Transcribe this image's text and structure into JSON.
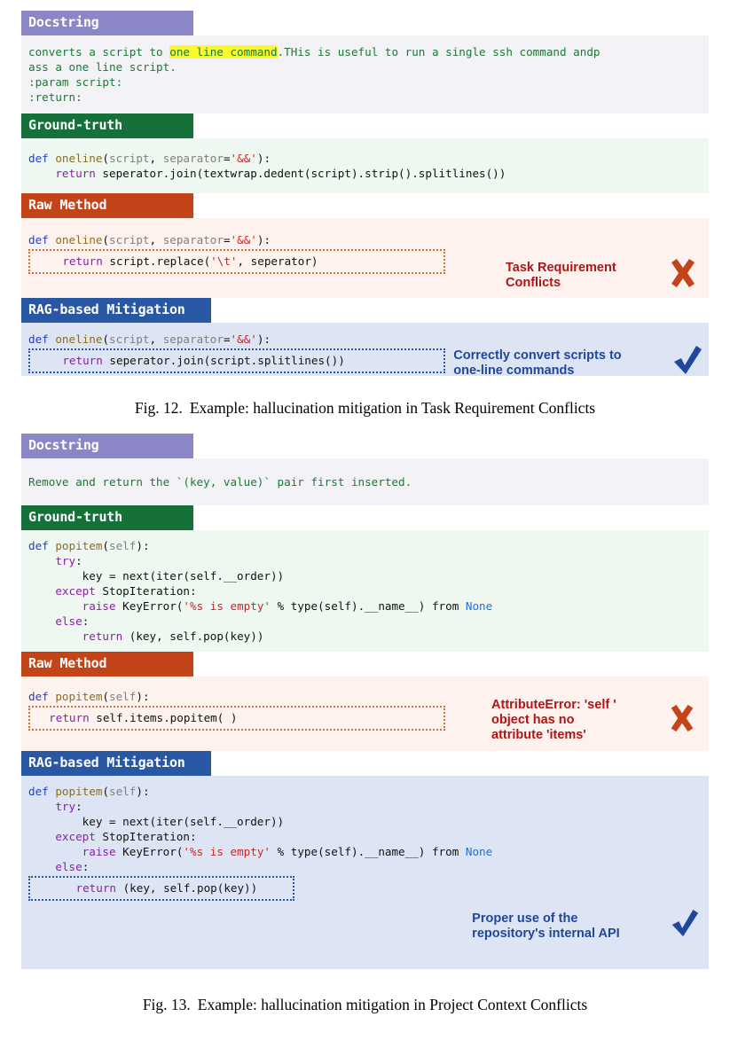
{
  "figures": [
    {
      "id": "fig-12",
      "panels": {
        "docstring": {
          "header": "Docstring",
          "line1_pre": "converts a script to ",
          "line1_hl": "one line command",
          "line1_post": ".THis is useful to run a single ssh command andp",
          "line2": "ass a one line script.",
          "line3": ":param script:",
          "line4": ":return:"
        },
        "ground_truth": {
          "header": "Ground-truth",
          "code": {
            "def_kw": "def",
            "fn": " oneline",
            "sig_open": "(",
            "arg1": "script",
            "sep": ", ",
            "arg2": "separator",
            "eq": "=",
            "str": "'&&'",
            "sig_close": "):",
            "ret_kw": "return",
            "ret_body": " seperator.join(textwrap.dedent(script).strip().splitlines())"
          }
        },
        "raw_method": {
          "header": "Raw Method",
          "code": {
            "def_kw": "def",
            "fn": " oneline",
            "sig_open": "(",
            "arg1": "script",
            "sep": ", ",
            "arg2": "separator",
            "eq": "=",
            "str": "'&&'",
            "sig_close": "):",
            "ret_kw": "return",
            "ret_mid": " script.replace(",
            "ret_str": "'\\t'",
            "ret_end": ", seperator)"
          },
          "annotation": "Task Requirement\nConflicts",
          "mark": "cross-icon"
        },
        "rag_mitigation": {
          "header": "RAG-based Mitigation",
          "code": {
            "def_kw": "def",
            "fn": " oneline",
            "sig_open": "(",
            "arg1": "script",
            "sep": ", ",
            "arg2": "separator",
            "eq": "=",
            "str": "'&&'",
            "sig_close": "):",
            "ret_kw": "return",
            "ret_body": " seperator.join(script.splitlines())"
          },
          "annotation": "Correctly convert scripts to\none-line commands",
          "mark": "check-icon"
        }
      },
      "caption_label": "Fig. 12.",
      "caption_text": "Example: hallucination mitigation in Task Requirement Conflicts"
    },
    {
      "id": "fig-13",
      "panels": {
        "docstring": {
          "header": "Docstring",
          "line1": "Remove and return the `(key, value)` pair first inserted."
        },
        "ground_truth": {
          "header": "Ground-truth",
          "code": {
            "def_kw": "def",
            "fn": " popitem",
            "sig_open": "(",
            "arg1": "self",
            "sig_close": "):",
            "try_kw": "try",
            "try_colon": ":",
            "key_line": "key = next(iter(self.__order))",
            "except_kw": "except",
            "except_rest": " StopIteration:",
            "raise_kw": "raise",
            "raise_mid": " KeyError(",
            "raise_str1": "'%s is empty'",
            "raise_mid2": " % type(self).__name__) from ",
            "raise_none": "None",
            "else_kw": "else",
            "else_colon": ":",
            "ret_kw": "return",
            "ret_body": " (key, self.pop(key))"
          }
        },
        "raw_method": {
          "header": "Raw Method",
          "code": {
            "def_kw": "def",
            "fn": " popitem",
            "sig_open": "(",
            "arg1": "self",
            "sig_close": "):",
            "ret_kw": "return",
            "ret_body": " self.items.popitem( )"
          },
          "annotation": "AttributeError: 'self '\nobject has no\nattribute 'items'",
          "mark": "cross-icon"
        },
        "rag_mitigation": {
          "header": "RAG-based Mitigation",
          "code": {
            "def_kw": "def",
            "fn": " popitem",
            "sig_open": "(",
            "arg1": "self",
            "sig_close": "):",
            "try_kw": "try",
            "try_colon": ":",
            "key_line": "key = next(iter(self.__order))",
            "except_kw": "except",
            "except_rest": " StopIteration:",
            "raise_kw": "raise",
            "raise_mid": " KeyError(",
            "raise_str1": "'%s is empty'",
            "raise_mid2": " % type(self).__name__) from ",
            "raise_none": "None",
            "else_kw": "else",
            "else_colon": ":",
            "ret_kw": "return",
            "ret_body": " (key, self.pop(key))"
          },
          "annotation": "Proper use of the\nrepository's internal API",
          "mark": "check-icon"
        }
      },
      "caption_label": "Fig. 13.",
      "caption_text": "Example: hallucination mitigation in Project Context Conflicts"
    }
  ],
  "colors": {
    "docstring_header": "#8b86c6",
    "ground_truth_header": "#16703a",
    "raw_method_header": "#c4441a",
    "rag_header": "#2857a4",
    "highlight": "#fcf92a",
    "bad_text": "#b01515",
    "cross": "#c4441a",
    "good_text": "#20479b",
    "check": "#20479b"
  }
}
